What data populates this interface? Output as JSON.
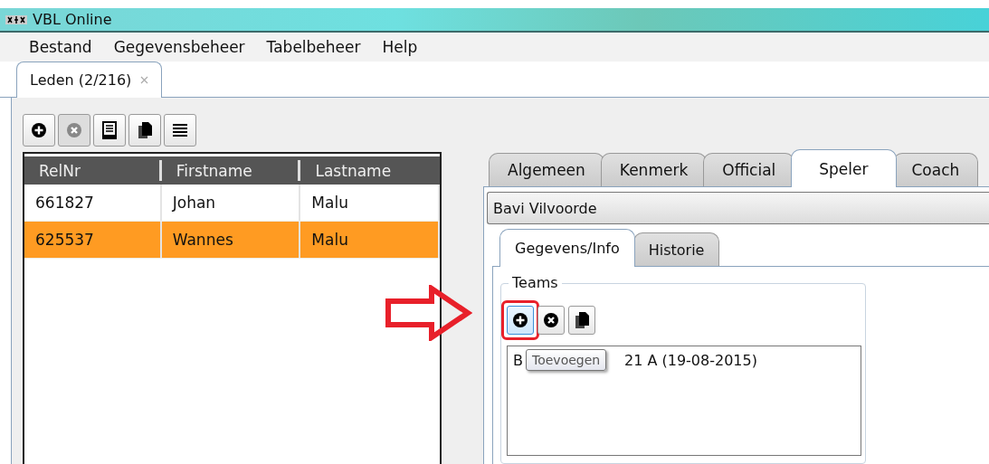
{
  "window": {
    "title": "VBL Online"
  },
  "menu": [
    "Bestand",
    "Gegevensbeheer",
    "Tabelbeheer",
    "Help"
  ],
  "doc_tabs": [
    {
      "label": "Leden (2/216)",
      "selected": true,
      "closable": true
    }
  ],
  "left_toolbar": [
    {
      "kind": "add",
      "disabled": false
    },
    {
      "kind": "remove",
      "disabled": true
    },
    {
      "kind": "form",
      "disabled": false
    },
    {
      "kind": "copy",
      "disabled": false
    },
    {
      "kind": "list",
      "disabled": false
    }
  ],
  "table": {
    "columns": [
      "RelNr",
      "Firstname",
      "Lastname"
    ],
    "rows": [
      {
        "cells": [
          "661827",
          "Johan",
          "Malu"
        ],
        "selected": false
      },
      {
        "cells": [
          "625537",
          "Wannes",
          "Malu"
        ],
        "selected": true
      }
    ]
  },
  "detail_tabs": [
    {
      "label": "Algemeen",
      "selected": false
    },
    {
      "label": "Kenmerk",
      "selected": false
    },
    {
      "label": "Official",
      "selected": false
    },
    {
      "label": "Speler",
      "selected": true
    },
    {
      "label": "Coach",
      "selected": false
    }
  ],
  "club_select": {
    "value": "Bavi Vilvoorde"
  },
  "sub_tabs": [
    {
      "label": "Gegevens/Info",
      "selected": true
    },
    {
      "label": "Historie",
      "selected": false
    }
  ],
  "teams": {
    "title": "Teams",
    "toolbar": [
      {
        "kind": "add",
        "highlighted": true
      },
      {
        "kind": "remove",
        "highlighted": false
      },
      {
        "kind": "copy",
        "highlighted": false
      }
    ],
    "items": [
      {
        "text_start": "B",
        "text_end": "21 A (19-08-2015)"
      }
    ],
    "tooltip": "Toevoegen"
  }
}
